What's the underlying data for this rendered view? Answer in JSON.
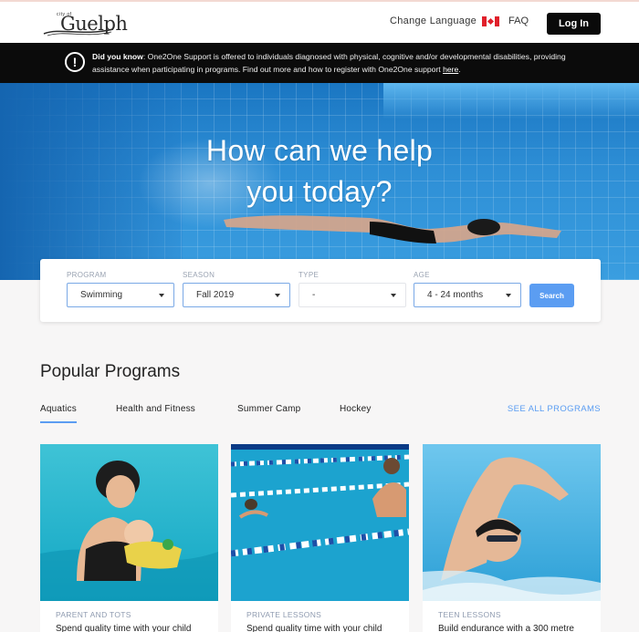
{
  "header": {
    "logo_small": "city of",
    "logo_text": "Guelph",
    "change_language": "Change Language",
    "faq": "FAQ",
    "login": "Log In"
  },
  "notice": {
    "title": "Did you know",
    "body": ": One2One Support is offered to individuals diagnosed with physical, cognitive and/or developmental disabilities, providing assistance when participating in programs. Find out more and how to register with One2One support ",
    "link": "here",
    "end": "."
  },
  "hero": {
    "line1": "How can we help",
    "line2": "you today?"
  },
  "search": {
    "program": {
      "label": "PROGRAM",
      "value": "Swimming"
    },
    "season": {
      "label": "SEASON",
      "value": "Fall 2019"
    },
    "type": {
      "label": "TYPE",
      "value": "-"
    },
    "age": {
      "label": "AGE",
      "value": "4 - 24 months"
    },
    "button": "Search"
  },
  "popular": {
    "title": "Popular Programs",
    "tabs": [
      "Aquatics",
      "Health and Fitness",
      "Summer Camp",
      "Hockey"
    ],
    "see_all": "SEE ALL PROGRAMS",
    "cards": [
      {
        "category": "PARENT AND TOTS",
        "desc": "Spend quality time with your child"
      },
      {
        "category": "PRIVATE LESSONS",
        "desc": "Spend quality time with your child"
      },
      {
        "category": "TEEN LESSONS",
        "desc": "Build endurance with a 300 metre"
      }
    ]
  },
  "colors": {
    "accent": "#5b9df2",
    "notice_bg": "#0b0b0b",
    "login_bg": "#0a0a0a"
  }
}
